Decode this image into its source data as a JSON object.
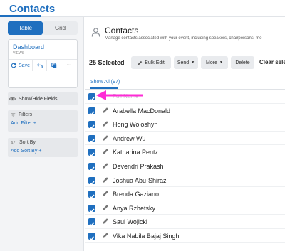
{
  "app": {
    "title": "Contacts"
  },
  "sidebar": {
    "view_toggle": {
      "table": "Table",
      "grid": "Grid"
    },
    "dashboard": {
      "title": "Dashboard",
      "subtitle": "VIEWS",
      "actions": {
        "save": "Save",
        "more": "···"
      }
    },
    "show_hide": "Show/Hide Fields",
    "filters": {
      "label": "Filters",
      "add": "Add Filter"
    },
    "sort": {
      "label": "Sort By",
      "add": "Add Sort By"
    }
  },
  "main": {
    "title": "Contacts",
    "description": "Manage contacts associated with your event, including speakers, chairpersons, mo",
    "toolbar": {
      "selected": "25 Selected",
      "bulk_edit": "Bulk Edit",
      "send": "Send",
      "more": "More",
      "delete": "Delete",
      "clear": "Clear sele"
    },
    "tabs": {
      "all": "Show All (97)"
    },
    "table": {
      "header": "Full Name",
      "rows": [
        "Arabella MacDonald",
        "Hong Woloshyn",
        "Andrew Wu",
        "Katharina Pentz",
        "Devendri Prakash",
        "Joshua Abu-Shiraz",
        "Brenda Gaziano",
        "Anya Rzhetsky",
        "Saul Wojicki",
        "Vika Nabila Bajaj Singh"
      ]
    }
  },
  "colors": {
    "accent": "#1f6fbf",
    "annotation_arrow": "#ff2bd6"
  }
}
